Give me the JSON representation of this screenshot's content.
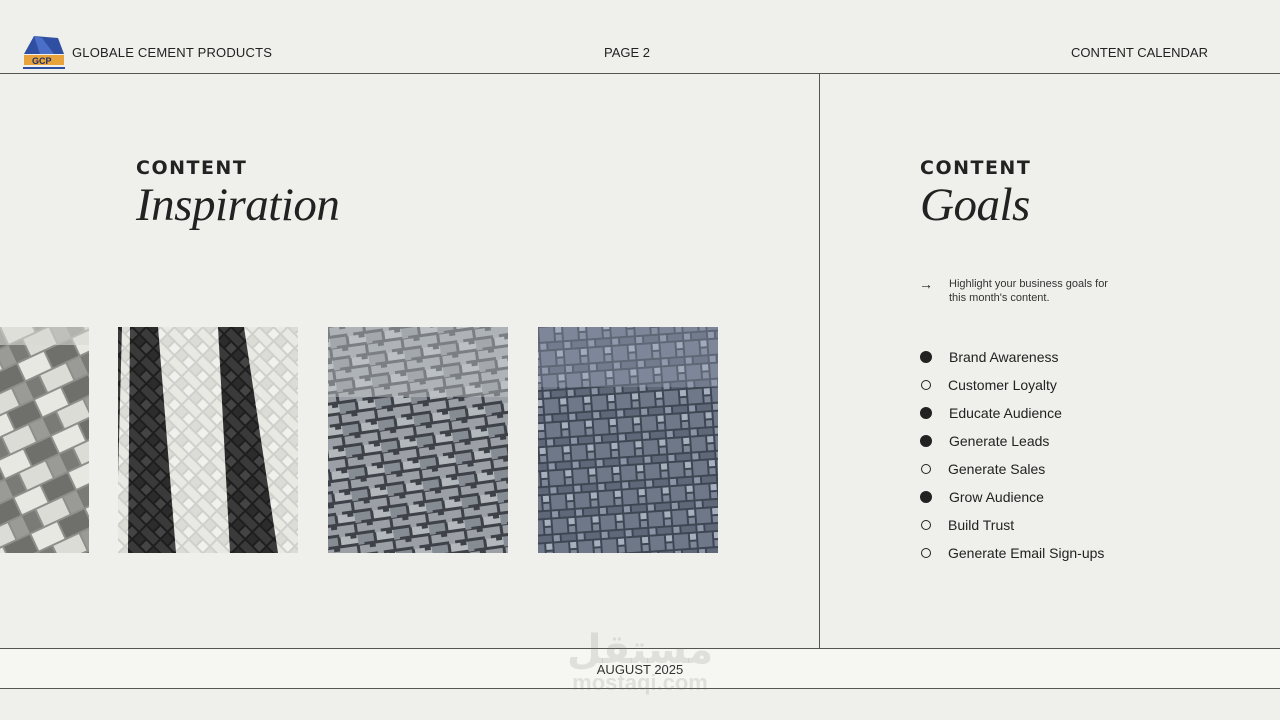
{
  "header": {
    "logo_text": "GCP",
    "company": "GLOBALE CEMENT PRODUCTS",
    "page": "PAGE 2",
    "calendar": "CONTENT CALENDAR"
  },
  "inspiration": {
    "kicker": "CONTENT",
    "title": "Inspiration",
    "tiles": [
      {
        "name": "grey-white-brick-paving"
      },
      {
        "name": "herringbone-chevron-paving"
      },
      {
        "name": "interlocking-zigzag-paving"
      },
      {
        "name": "blue-grey-square-paving"
      }
    ]
  },
  "goals": {
    "kicker": "CONTENT",
    "title": "Goals",
    "intro": "Highlight your business goals for this month's content.",
    "items": [
      {
        "label": "Brand Awareness",
        "checked": true
      },
      {
        "label": "Customer Loyalty",
        "checked": false
      },
      {
        "label": "Educate Audience",
        "checked": true
      },
      {
        "label": "Generate Leads",
        "checked": true
      },
      {
        "label": "Generate Sales",
        "checked": false
      },
      {
        "label": "Grow Audience",
        "checked": true
      },
      {
        "label": "Build Trust",
        "checked": false
      },
      {
        "label": "Generate Email Sign-ups",
        "checked": false
      }
    ]
  },
  "footer": {
    "date": "AUGUST 2025"
  },
  "watermark": {
    "arabic": "مستقل",
    "latin": "mostaqi.com"
  },
  "colors": {
    "background": "#efefeb",
    "ink": "#222222",
    "logo_blue": "#2f4fa3",
    "logo_orange": "#e8a33d"
  }
}
